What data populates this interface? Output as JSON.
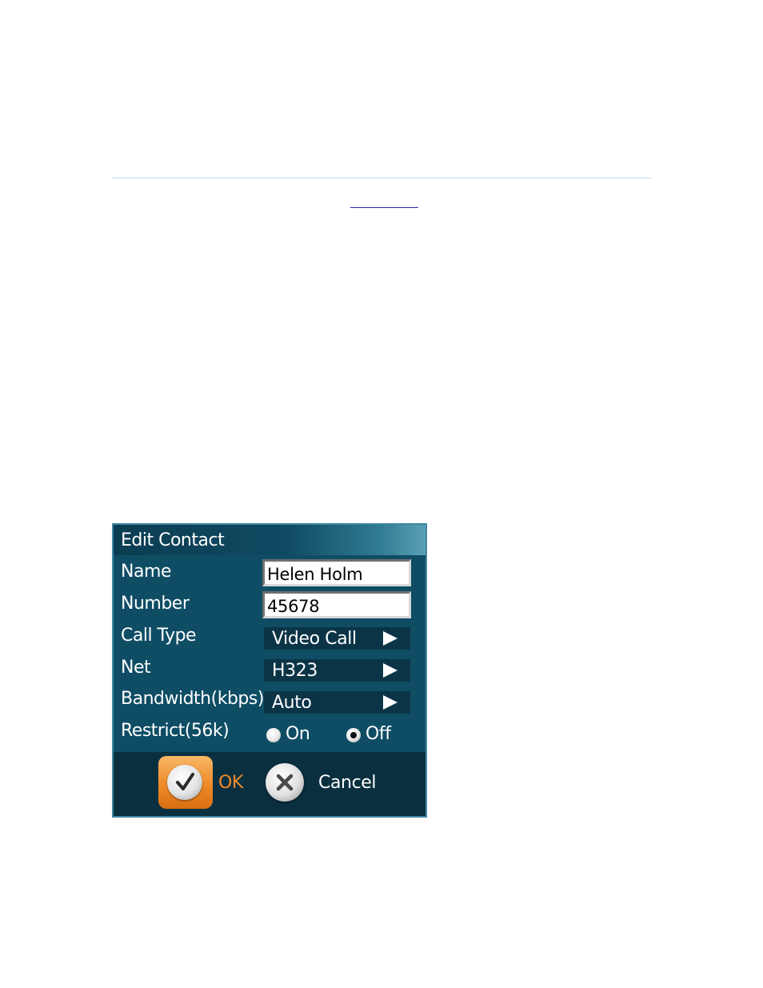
{
  "dialog": {
    "title": "Edit Contact",
    "fields": {
      "name": {
        "label": "Name",
        "value": "Helen Holm"
      },
      "number": {
        "label": "Number",
        "value": "45678"
      },
      "call_type": {
        "label": "Call Type",
        "value": "Video Call"
      },
      "net": {
        "label": "Net",
        "value": "H323"
      },
      "bandwidth": {
        "label": "Bandwidth(kbps)",
        "value": "Auto"
      },
      "restrict": {
        "label": "Restrict(56k)",
        "options": [
          "On",
          "Off"
        ],
        "selected": "Off"
      }
    },
    "buttons": {
      "ok_label": "OK",
      "cancel_label": "Cancel"
    }
  },
  "colors": {
    "dialog_bg": "#0f4d65",
    "selector_bg": "#0b3447",
    "footer_bg": "#0a3040",
    "ok_accent": "#f08a2a",
    "border": "#3f86a3"
  }
}
